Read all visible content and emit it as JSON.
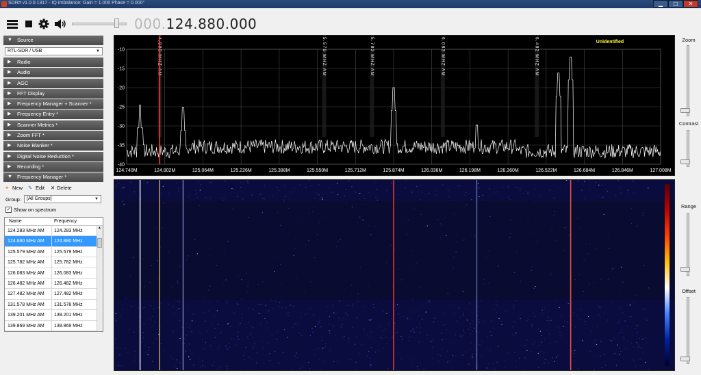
{
  "window": {
    "title": "SDR# v1.0.0.1317 - IQ Imbalance: Gain = 1.000 Phase = 0.000°",
    "minimize": "▁",
    "maximize": "▢",
    "close": "✕"
  },
  "toolbar": {
    "frequency_lead": "000.",
    "frequency_main": "124.880.000",
    "icons": [
      "menu-icon",
      "stop-icon",
      "gear-icon",
      "speaker-icon"
    ],
    "volume_level": 0.8
  },
  "panel": {
    "source_section": "Source",
    "source_value": "RTL-SDR / USB",
    "sections": [
      "Radio",
      "Audio",
      "AGC",
      "FFT Display",
      "Frequency Manager + Scanner *",
      "Frequency Entry *",
      "Scanner Metrics *",
      "Zoom FFT *",
      "Noise Blanker *",
      "Digital Noise Reduction *",
      "Recording *"
    ],
    "fm_section": "Frequency Manager *",
    "new_label": "New",
    "edit_label": "Edit",
    "delete_label": "Delete",
    "group_label": "Group:",
    "group_value": "[All Groups]",
    "show_label": "Show on spectrum",
    "table": {
      "col_name": "Name",
      "col_freq": "Frequency",
      "rows": [
        [
          "124.283 MHz AM",
          "124.283 MHz"
        ],
        [
          "124.880 MHz AM",
          "124.880 MHz"
        ],
        [
          "125.579 MHz AM",
          "125.579 MHz"
        ],
        [
          "125.782 MHz AM",
          "125.782 MHz"
        ],
        [
          "126.083 MHz AM",
          "126.083 MHz"
        ],
        [
          "126.482 MHz AM",
          "126.482 MHz"
        ],
        [
          "127.482 MHz AM",
          "127.482 MHz"
        ],
        [
          "131.578 MHz AM",
          "131.578 MHz"
        ],
        [
          "139.201 MHz AM",
          "139.201 MHz"
        ],
        [
          "139.869 MHz AM",
          "139.869 MHz"
        ]
      ],
      "selected_index": 1
    }
  },
  "spectrum": {
    "status": "Unidentified",
    "y_ticks": [
      "-10",
      "-15",
      "-20",
      "-25",
      "-30",
      "-35",
      "-40"
    ],
    "x_ticks": [
      "124.740M",
      "124.902M",
      "125.064M",
      "125.226M",
      "125.388M",
      "125.550M",
      "125.712M",
      "125.874M",
      "126.036M",
      "126.198M",
      "126.360M",
      "126.522M",
      "126.684M",
      "126.846M",
      "127.008M"
    ],
    "markers": [
      {
        "label": "124.880 MHZ AM",
        "freq": 124.88
      },
      {
        "label": "125.579 MHZ AM",
        "freq": 125.579
      },
      {
        "label": "125.782 MHZ AM",
        "freq": 125.782
      },
      {
        "label": "126.083 MHZ AM",
        "freq": 126.083
      },
      {
        "label": "126.482 MHZ AM",
        "freq": 126.482
      }
    ],
    "tuned_freq": 124.88,
    "freq_range": [
      124.74,
      127.008
    ],
    "db_range": [
      -40,
      -10
    ],
    "noise_floor_db": -38.5,
    "peaks": [
      {
        "freq": 124.797,
        "db": -24.5
      },
      {
        "freq": 124.902,
        "db": -40.0
      },
      {
        "freq": 124.98,
        "db": -25.2
      },
      {
        "freq": 125.874,
        "db": -20.0
      },
      {
        "freq": 126.227,
        "db": -29.8
      },
      {
        "freq": 126.626,
        "db": -12.0
      },
      {
        "freq": 126.574,
        "db": -16.2
      }
    ],
    "colors": {
      "trace": "#ffffff",
      "grid": "#4a4a4a",
      "marker": "#ffffff",
      "tuned": "#ff3030",
      "status": "#ffff40"
    }
  },
  "waterfall": {
    "lines": [
      {
        "freq": 124.797,
        "color": "#ffffff",
        "opacity": 0.85
      },
      {
        "freq": 124.88,
        "color": "#ffd060",
        "opacity": 0.7
      },
      {
        "freq": 124.98,
        "color": "#c0d0ff",
        "opacity": 0.55
      },
      {
        "freq": 125.874,
        "color": "#ff3a2a",
        "opacity": 0.9
      },
      {
        "freq": 126.227,
        "color": "#a0b8ff",
        "opacity": 0.5
      },
      {
        "freq": 126.626,
        "color": "#ff5a40",
        "opacity": 0.9
      }
    ],
    "colormap": [
      "#5a0000",
      "#c00000",
      "#ff4000",
      "#ffc000",
      "#ffffff",
      "#4080ff",
      "#0020a0",
      "#000030"
    ]
  },
  "right_controls": {
    "zoom_label": "Zoom",
    "contrast_label": "Contrast",
    "range_label": "Range",
    "offset_label": "Offset",
    "zoom_value": 0.0,
    "contrast_value": 0.0,
    "range_value": 0.0,
    "offset_value": 0.0
  }
}
